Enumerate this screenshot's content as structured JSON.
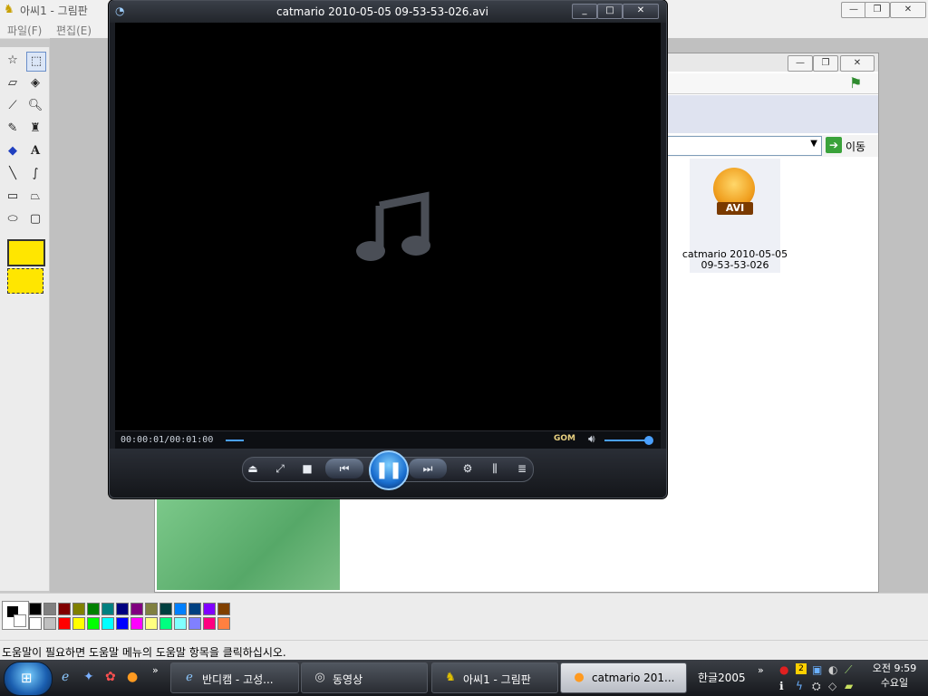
{
  "paint": {
    "title": "아씨1 - 그림판",
    "menu": [
      "파일(F)",
      "편집(E)"
    ],
    "status": "도움말이 필요하면 도움말 메뉴의 도움말 항목을 클릭하십시오.",
    "palette_top": [
      "#000000",
      "#808080",
      "#800000",
      "#808000",
      "#008000",
      "#008080",
      "#000080",
      "#800080",
      "#808040",
      "#004040",
      "#0080ff",
      "#004080",
      "#8000ff",
      "#804000"
    ],
    "palette_bottom": [
      "#ffffff",
      "#c0c0c0",
      "#ff0000",
      "#ffff00",
      "#00ff00",
      "#00ffff",
      "#0000ff",
      "#ff00ff",
      "#ffff80",
      "#00ff80",
      "#80ffff",
      "#8080ff",
      "#ff0080",
      "#ff8040"
    ]
  },
  "explorer": {
    "go_label": "이동",
    "file_name_line1": "catmario 2010-05-05",
    "file_name_line2": "09-53-53-026",
    "file_badge": "AVI"
  },
  "player": {
    "title": "catmario 2010-05-05 09-53-53-026.avi",
    "time": "00:00:01/00:01:00",
    "brand": "GOM",
    "icons": [
      "eject-icon",
      "expand-icon",
      "stop-icon",
      "previous-icon",
      "pause-icon",
      "next-icon",
      "settings-icon",
      "equalizer-icon",
      "playlist-icon",
      "volume-icon"
    ]
  },
  "taskbar": {
    "tasks": [
      "반디캠 - 고성...",
      "동영상",
      "아씨1 - 그림판",
      "catmario 201..."
    ],
    "ime": "한글2005",
    "clock_time": "오전 9:59",
    "clock_day": "수요일"
  }
}
